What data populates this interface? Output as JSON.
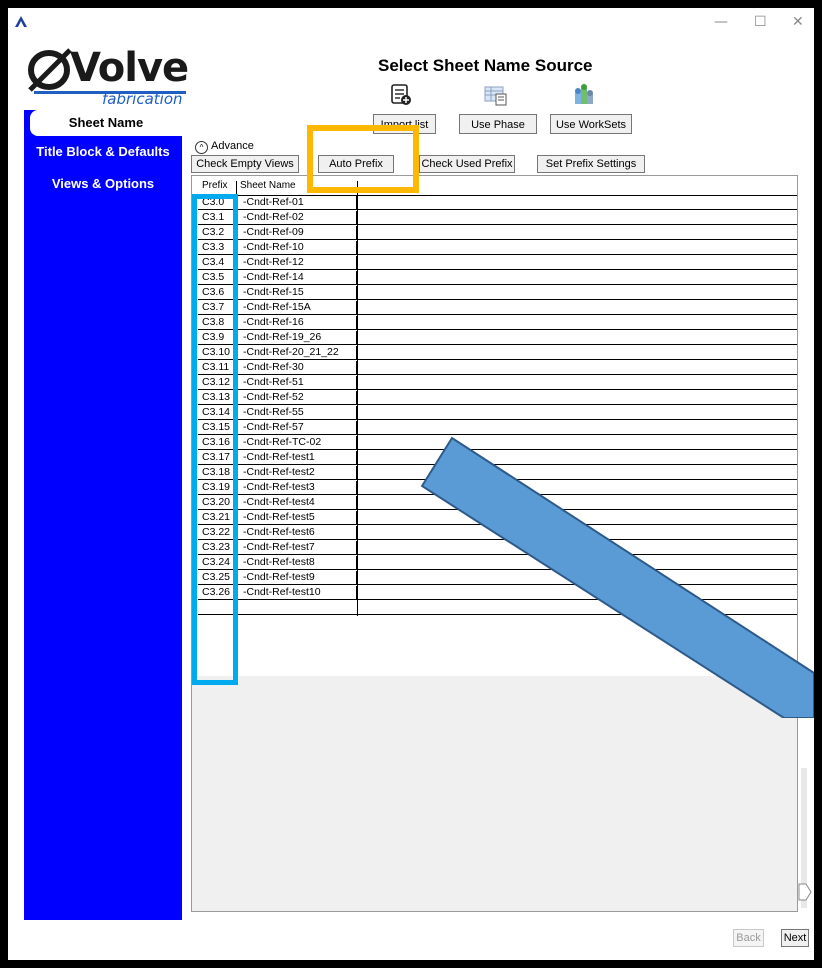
{
  "window": {
    "minimize": "—",
    "maximize": "☐",
    "close": "✕"
  },
  "logo": {
    "main": "Volve",
    "sub": "fabrication"
  },
  "sidebar": {
    "items": [
      {
        "label": "Sheet Name"
      },
      {
        "label": "Title Block & Defaults"
      },
      {
        "label": "Views & Options"
      }
    ]
  },
  "header": {
    "title": "Select Sheet Name Source"
  },
  "source_buttons": {
    "import": "Import list",
    "phase": "Use Phase",
    "worksets": "Use WorkSets"
  },
  "advance": {
    "label": "Advance"
  },
  "toolbar": {
    "check_empty": "Check Empty Views",
    "auto_prefix": "Auto Prefix",
    "check_used": "Check Used Prefix",
    "prefix_settings": "Set Prefix Settings"
  },
  "grid": {
    "columns": [
      "Prefix",
      "Sheet Name"
    ],
    "rows": [
      [
        "C3.0",
        "-Cndt-Ref-01"
      ],
      [
        "C3.1",
        "-Cndt-Ref-02"
      ],
      [
        "C3.2",
        "-Cndt-Ref-09"
      ],
      [
        "C3.3",
        "-Cndt-Ref-10"
      ],
      [
        "C3.4",
        "-Cndt-Ref-12"
      ],
      [
        "C3.5",
        "-Cndt-Ref-14"
      ],
      [
        "C3.6",
        "-Cndt-Ref-15"
      ],
      [
        "C3.7",
        "-Cndt-Ref-15A"
      ],
      [
        "C3.8",
        "-Cndt-Ref-16"
      ],
      [
        "C3.9",
        "-Cndt-Ref-19_26"
      ],
      [
        "C3.10",
        "-Cndt-Ref-20_21_22"
      ],
      [
        "C3.11",
        "-Cndt-Ref-30"
      ],
      [
        "C3.12",
        "-Cndt-Ref-51"
      ],
      [
        "C3.13",
        "-Cndt-Ref-52"
      ],
      [
        "C3.14",
        "-Cndt-Ref-55"
      ],
      [
        "C3.15",
        "-Cndt-Ref-57"
      ],
      [
        "C3.16",
        "-Cndt-Ref-TC-02"
      ],
      [
        "C3.17",
        "-Cndt-Ref-test1"
      ],
      [
        "C3.18",
        "-Cndt-Ref-test2"
      ],
      [
        "C3.19",
        "-Cndt-Ref-test3"
      ],
      [
        "C3.20",
        "-Cndt-Ref-test4"
      ],
      [
        "C3.21",
        "-Cndt-Ref-test5"
      ],
      [
        "C3.22",
        "-Cndt-Ref-test6"
      ],
      [
        "C3.23",
        "-Cndt-Ref-test7"
      ],
      [
        "C3.24",
        "-Cndt-Ref-test8"
      ],
      [
        "C3.25",
        "-Cndt-Ref-test9"
      ],
      [
        "C3.26",
        "-Cndt-Ref-test10"
      ]
    ]
  },
  "nav": {
    "back": "Back",
    "next": "Next"
  },
  "colors": {
    "sidebar": "#0000ff",
    "highlight_prefix": "#00aaee",
    "highlight_auto_prefix": "#ffb800",
    "arrow": "#5b9bd5"
  }
}
